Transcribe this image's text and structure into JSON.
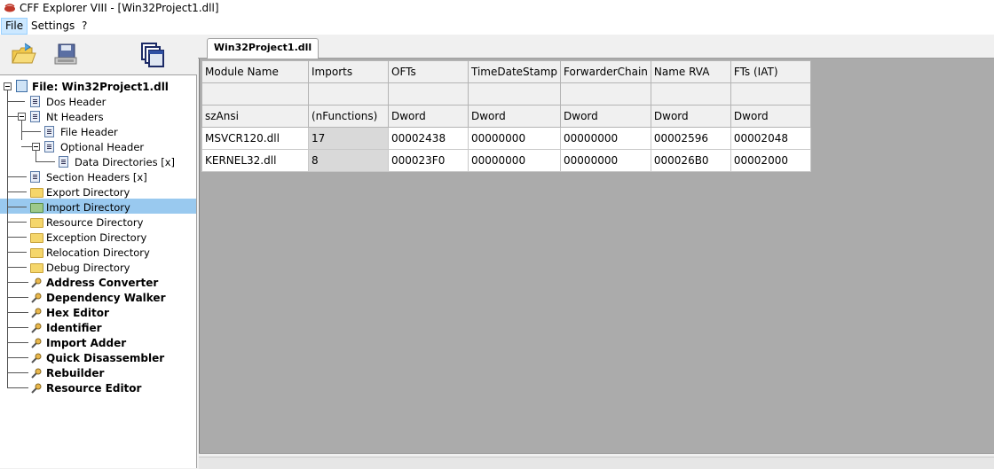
{
  "window": {
    "title": "CFF Explorer VIII - [Win32Project1.dll]"
  },
  "menu": {
    "file": "File",
    "settings": "Settings",
    "help": "?"
  },
  "toolbar": {
    "open_icon": "open-folder-icon",
    "save_icon": "save-disk-icon",
    "windows_icon": "windows-cascade-icon"
  },
  "tab": {
    "label": "Win32Project1.dll"
  },
  "tree": {
    "root": "File: Win32Project1.dll",
    "items": [
      "Dos Header",
      "Nt Headers",
      "File Header",
      "Optional Header",
      "Data Directories [x]",
      "Section Headers [x]",
      "Export Directory",
      "Import Directory",
      "Resource Directory",
      "Exception Directory",
      "Relocation Directory",
      "Debug Directory"
    ],
    "tools": [
      "Address Converter",
      "Dependency Walker",
      "Hex Editor",
      "Identifier",
      "Import Adder",
      "Quick Disassembler",
      "Rebuilder",
      "Resource Editor"
    ]
  },
  "table": {
    "columns": [
      "Module Name",
      "Imports",
      "OFTs",
      "TimeDateStamp",
      "ForwarderChain",
      "Name RVA",
      "FTs (IAT)"
    ],
    "blank": [
      "",
      "",
      "",
      "",
      "",
      "",
      ""
    ],
    "types": [
      "szAnsi",
      "(nFunctions)",
      "Dword",
      "Dword",
      "Dword",
      "Dword",
      "Dword"
    ],
    "rows": [
      [
        "MSVCR120.dll",
        "17",
        "00002438",
        "00000000",
        "00000000",
        "00002596",
        "00002048"
      ],
      [
        "KERNEL32.dll",
        "8",
        "000023F0",
        "00000000",
        "00000000",
        "000026B0",
        "00002000"
      ]
    ]
  }
}
